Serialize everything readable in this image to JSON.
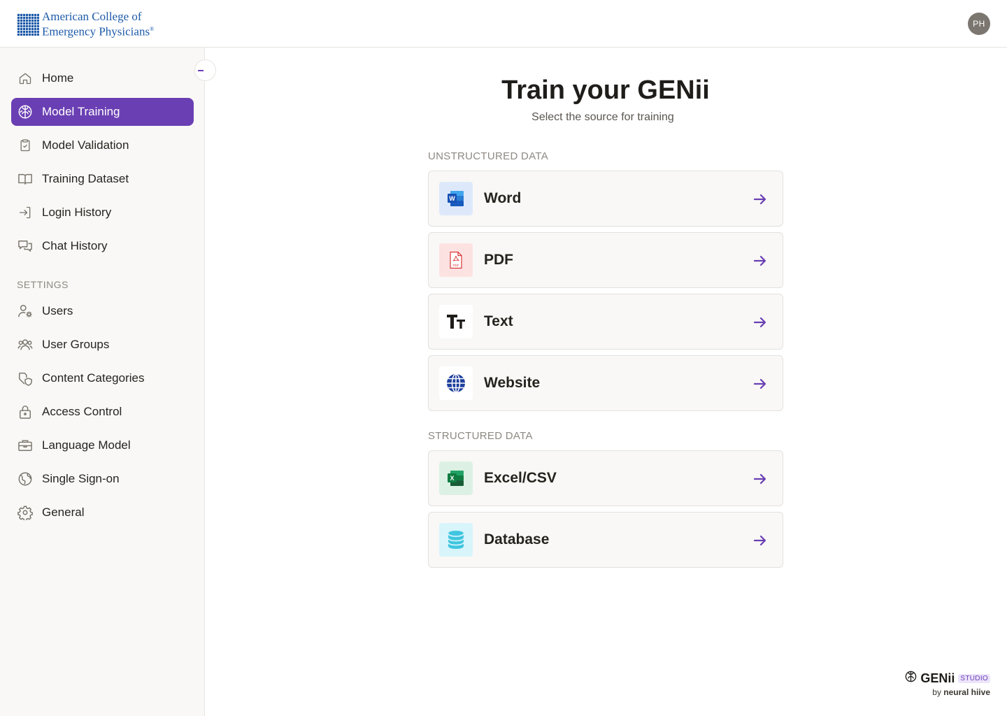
{
  "header": {
    "logo_line1": "American College of",
    "logo_line2": "Emergency Physicians",
    "logo_reg": "®",
    "avatar_initials": "PH"
  },
  "sidebar": {
    "items": [
      {
        "label": "Home",
        "icon": "home-icon"
      },
      {
        "label": "Model Training",
        "icon": "brain-icon",
        "active": true
      },
      {
        "label": "Model Validation",
        "icon": "clipboard-check-icon"
      },
      {
        "label": "Training Dataset",
        "icon": "book-open-icon"
      },
      {
        "label": "Login History",
        "icon": "login-arrow-icon"
      },
      {
        "label": "Chat History",
        "icon": "chat-bubbles-icon"
      }
    ],
    "settings_title": "SETTINGS",
    "settings_items": [
      {
        "label": "Users",
        "icon": "user-gear-icon"
      },
      {
        "label": "User Groups",
        "icon": "users-group-icon"
      },
      {
        "label": "Content Categories",
        "icon": "tag-shield-icon"
      },
      {
        "label": "Access Control",
        "icon": "lock-icon"
      },
      {
        "label": "Language Model",
        "icon": "briefcase-icon"
      },
      {
        "label": "Single Sign-on",
        "icon": "globe-icon"
      },
      {
        "label": "General",
        "icon": "gear-icon"
      }
    ]
  },
  "main": {
    "title": "Train your GENii",
    "subtitle": "Select the source for training",
    "unstructured_label": "UNSTRUCTURED DATA",
    "unstructured": [
      {
        "label": "Word",
        "icon": "word-icon"
      },
      {
        "label": "PDF",
        "icon": "pdf-icon"
      },
      {
        "label": "Text",
        "icon": "text-icon"
      },
      {
        "label": "Website",
        "icon": "globe-icon"
      }
    ],
    "structured_label": "STRUCTURED DATA",
    "structured": [
      {
        "label": "Excel/CSV",
        "icon": "excel-icon"
      },
      {
        "label": "Database",
        "icon": "database-icon"
      }
    ]
  },
  "brand": {
    "name": "GENii",
    "badge": "STUDIO",
    "by": "by",
    "company": "neural hiive"
  },
  "colors": {
    "accent": "#6a3fb3",
    "logo_blue": "#1d5aa8",
    "sidebar_bg": "#f9f8f6"
  }
}
